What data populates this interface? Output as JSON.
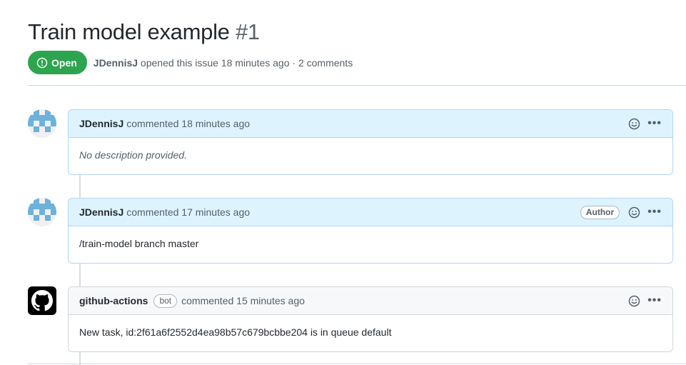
{
  "issue": {
    "title": "Train model example",
    "number": "#1",
    "state": "Open",
    "author": "JDennisJ",
    "opened_text": "opened this issue 18 minutes ago · 2 comments"
  },
  "comments": [
    {
      "author": "JDennisJ",
      "time": "commented 18 minutes ago",
      "body": "No description provided.",
      "avatar": "identicon"
    },
    {
      "author": "JDennisJ",
      "time": "commented 17 minutes ago",
      "label": "Author",
      "body": "/train-model branch master",
      "avatar": "identicon"
    },
    {
      "author": "github-actions",
      "label": "bot",
      "time": "commented 15 minutes ago",
      "body": "New task, id:2f61a6f2552d4ea98b57c679bcbbe204 is in queue default",
      "avatar": "github-logo"
    }
  ],
  "colors": {
    "open_green": "#2da44e",
    "author_header": "#ddf4ff",
    "identicon": "#6cb2da"
  },
  "icons": [
    "issue-opened-icon",
    "smiley-icon",
    "kebab-horizontal-icon",
    "github-mark-icon"
  ]
}
